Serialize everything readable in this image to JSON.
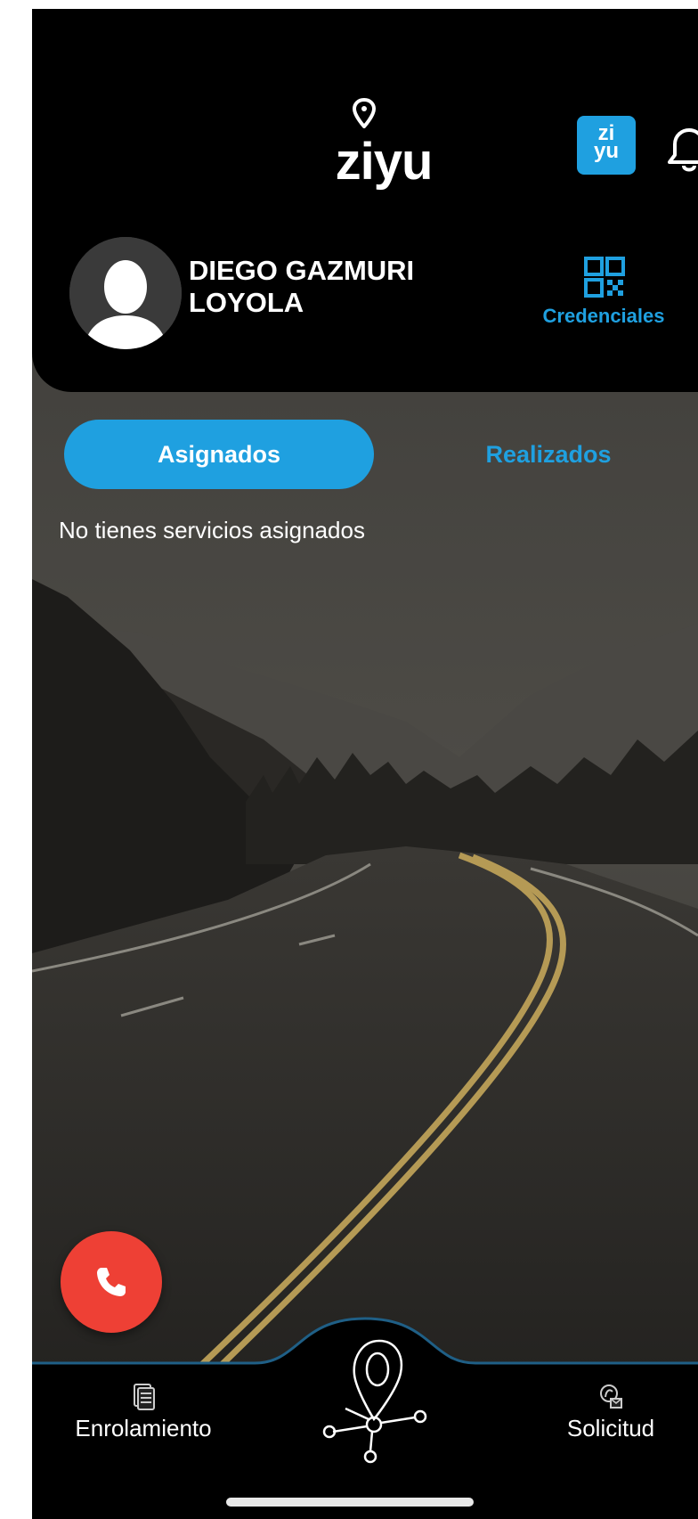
{
  "app": {
    "logo_text": "ziyu",
    "badge_line1": "zi",
    "badge_line2": "yu"
  },
  "user": {
    "name": "DIEGO GAZMURI\nLOYOLA"
  },
  "credentials": {
    "label": "Credenciales",
    "icon": "qr-code-icon"
  },
  "tabs": [
    {
      "label": "Asignados",
      "active": true
    },
    {
      "label": "Realizados",
      "active": false
    }
  ],
  "empty_message": "No tienes servicios asignados",
  "bottom_nav": {
    "left_label": "Enrolamiento",
    "right_label": "Solicitud"
  },
  "colors": {
    "accent": "#1fa0e0",
    "call": "#ee4035",
    "header_bg": "#000000"
  }
}
